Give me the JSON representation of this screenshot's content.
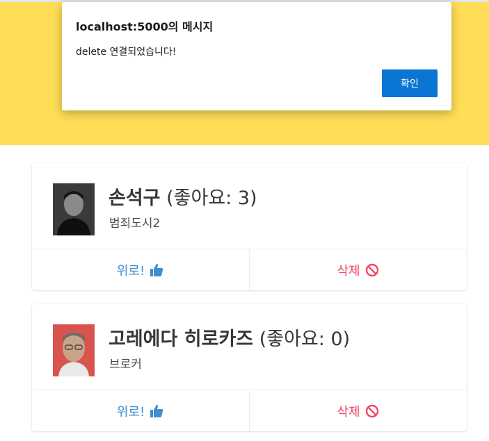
{
  "dialog": {
    "title": "localhost:5000의 메시지",
    "message": "delete 연결되었습니다!",
    "ok_label": "확인"
  },
  "colors": {
    "hero": "#ffdd57",
    "like": "#3e8ed0",
    "delete": "#f14668",
    "ok_button": "#0b75d4"
  },
  "cards": [
    {
      "name": "손석구",
      "likes_text": "(좋아요: 3)",
      "movie": "범죄도시2",
      "like_label": "위로!",
      "delete_label": "삭제",
      "like_icon": "thumbs-up-icon",
      "delete_icon": "ban-icon"
    },
    {
      "name": "고레에다 히로카즈",
      "likes_text": "(좋아요: 0)",
      "movie": "브로커",
      "like_label": "위로!",
      "delete_label": "삭제",
      "like_icon": "thumbs-up-icon",
      "delete_icon": "ban-icon"
    }
  ]
}
